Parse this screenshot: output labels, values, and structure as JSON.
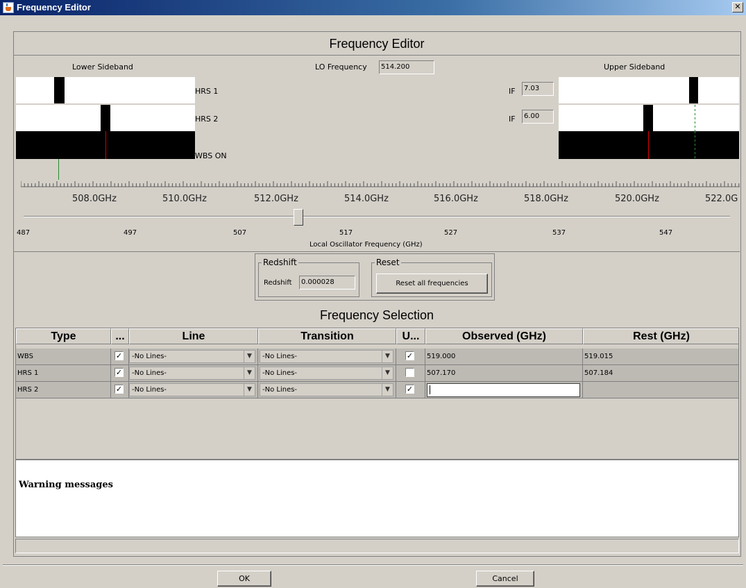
{
  "window": {
    "title": "Frequency Editor",
    "close_glyph": "✕"
  },
  "editor": {
    "heading": "Frequency Editor",
    "lower_sideband_label": "Lower Sideband",
    "upper_sideband_label": "Upper Sideband",
    "lo_frequency_label": "LO Frequency",
    "lo_frequency_value": "514.200",
    "band_labels": {
      "hrs1": "HRS 1",
      "hrs2": "HRS 2",
      "wbs": "WBS ON"
    },
    "if_label": "IF",
    "if_hrs1": "7.03",
    "if_hrs2": "6.00",
    "ruler_ticks": [
      "508.0GHz",
      "510.0GHz",
      "512.0GHz",
      "514.0GHz",
      "516.0GHz",
      "518.0GHz",
      "520.0GHz",
      "522.0G"
    ],
    "slider": {
      "value_ghz": 514.2,
      "min": 487,
      "max": 557,
      "labels": [
        "487",
        "497",
        "507",
        "517",
        "527",
        "537",
        "547"
      ],
      "caption": "Local Oscillator Frequency (GHz)"
    }
  },
  "redshift": {
    "group_title": "Redshift",
    "label": "Redshift",
    "value": "0.000028"
  },
  "reset": {
    "group_title": "Reset",
    "button_label": "Reset all frequencies"
  },
  "selection": {
    "heading": "Frequency Selection",
    "columns": [
      "Type",
      "...",
      "Line",
      "Transition",
      "U...",
      "Observed (GHz)",
      "Rest (GHz)"
    ],
    "rows": [
      {
        "type": "WBS",
        "enabled": true,
        "line": "-No Lines-",
        "transition": "-No Lines-",
        "use": true,
        "observed": "519.000",
        "rest": "519.015"
      },
      {
        "type": "HRS 1",
        "enabled": true,
        "line": "-No Lines-",
        "transition": "-No Lines-",
        "use": false,
        "observed": "507.170",
        "rest": "507.184"
      },
      {
        "type": "HRS 2",
        "enabled": true,
        "line": "-No Lines-",
        "transition": "-No Lines-",
        "use": true,
        "observed": "",
        "rest": ""
      }
    ]
  },
  "warnings": {
    "title": "Warning messages"
  },
  "buttons": {
    "ok": "OK",
    "cancel": "Cancel"
  },
  "glyphs": {
    "check": "✓",
    "dropdown": "▼"
  },
  "colors": {
    "title_bar": "#0a246a",
    "marker_red": "#dd0000",
    "marker_green": "#2a8a2a"
  }
}
